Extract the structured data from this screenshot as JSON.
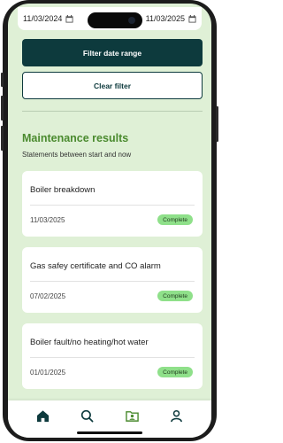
{
  "filter": {
    "start_date": "11/03/2024",
    "end_date": "11/03/2025",
    "filter_button": "Filter date range",
    "clear_button": "Clear filter"
  },
  "results": {
    "title": "Maintenance results",
    "subtitle": "Statements between start and now",
    "items": [
      {
        "title": "Boiler breakdown",
        "date": "11/03/2025",
        "status": "Complete"
      },
      {
        "title": "Gas safey certificate and CO alarm",
        "date": "07/02/2025",
        "status": "Complete"
      },
      {
        "title": "Boiler fault/no heating/hot water",
        "date": "01/01/2025",
        "status": "Complete"
      }
    ]
  },
  "tabbar": {
    "tabs": [
      {
        "icon": "home-icon"
      },
      {
        "icon": "search-icon"
      },
      {
        "icon": "folder-person-icon",
        "active": true
      },
      {
        "icon": "profile-icon"
      }
    ]
  },
  "colors": {
    "background": "#dff0d6",
    "primary": "#0d3a3d",
    "accent": "#4a8a2e",
    "badge": "#8fe08a"
  }
}
